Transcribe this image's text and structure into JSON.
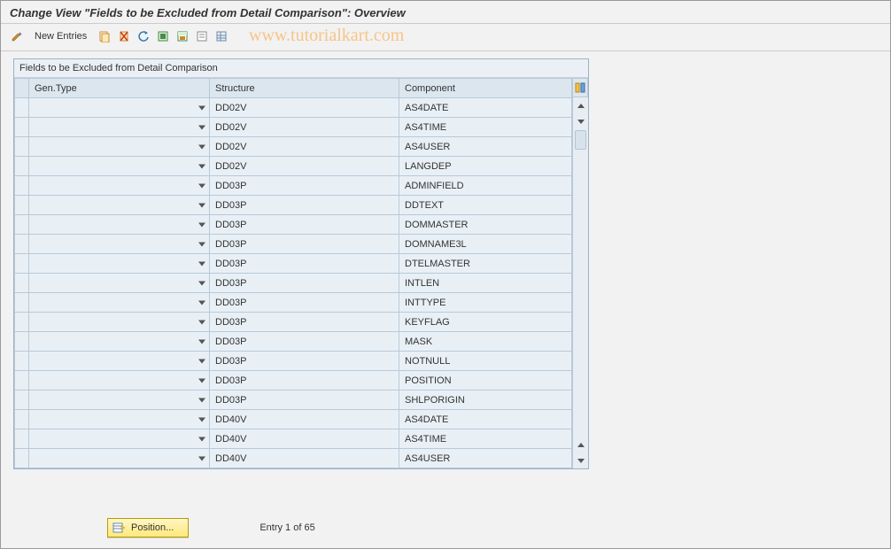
{
  "title": "Change View \"Fields to be Excluded from Detail Comparison\": Overview",
  "watermark": "www.tutorialkart.com",
  "toolbar": {
    "new_entries_label": "New Entries"
  },
  "panel": {
    "header": "Fields to be Excluded from Detail Comparison",
    "columns": {
      "gentype": "Gen.Type",
      "structure": "Structure",
      "component": "Component"
    }
  },
  "rows": [
    {
      "gentype": "",
      "structure": "DD02V",
      "component": "AS4DATE"
    },
    {
      "gentype": "",
      "structure": "DD02V",
      "component": "AS4TIME"
    },
    {
      "gentype": "",
      "structure": "DD02V",
      "component": "AS4USER"
    },
    {
      "gentype": "",
      "structure": "DD02V",
      "component": "LANGDEP"
    },
    {
      "gentype": "",
      "structure": "DD03P",
      "component": "ADMINFIELD"
    },
    {
      "gentype": "",
      "structure": "DD03P",
      "component": "DDTEXT"
    },
    {
      "gentype": "",
      "structure": "DD03P",
      "component": "DOMMASTER"
    },
    {
      "gentype": "",
      "structure": "DD03P",
      "component": "DOMNAME3L"
    },
    {
      "gentype": "",
      "structure": "DD03P",
      "component": "DTELMASTER"
    },
    {
      "gentype": "",
      "structure": "DD03P",
      "component": "INTLEN"
    },
    {
      "gentype": "",
      "structure": "DD03P",
      "component": "INTTYPE"
    },
    {
      "gentype": "",
      "structure": "DD03P",
      "component": "KEYFLAG"
    },
    {
      "gentype": "",
      "structure": "DD03P",
      "component": "MASK"
    },
    {
      "gentype": "",
      "structure": "DD03P",
      "component": "NOTNULL"
    },
    {
      "gentype": "",
      "structure": "DD03P",
      "component": "POSITION"
    },
    {
      "gentype": "",
      "structure": "DD03P",
      "component": "SHLPORIGIN"
    },
    {
      "gentype": "",
      "structure": "DD40V",
      "component": "AS4DATE"
    },
    {
      "gentype": "",
      "structure": "DD40V",
      "component": "AS4TIME"
    },
    {
      "gentype": "",
      "structure": "DD40V",
      "component": "AS4USER"
    }
  ],
  "footer": {
    "position_label": "Position...",
    "entry_label": "Entry 1 of 65"
  }
}
